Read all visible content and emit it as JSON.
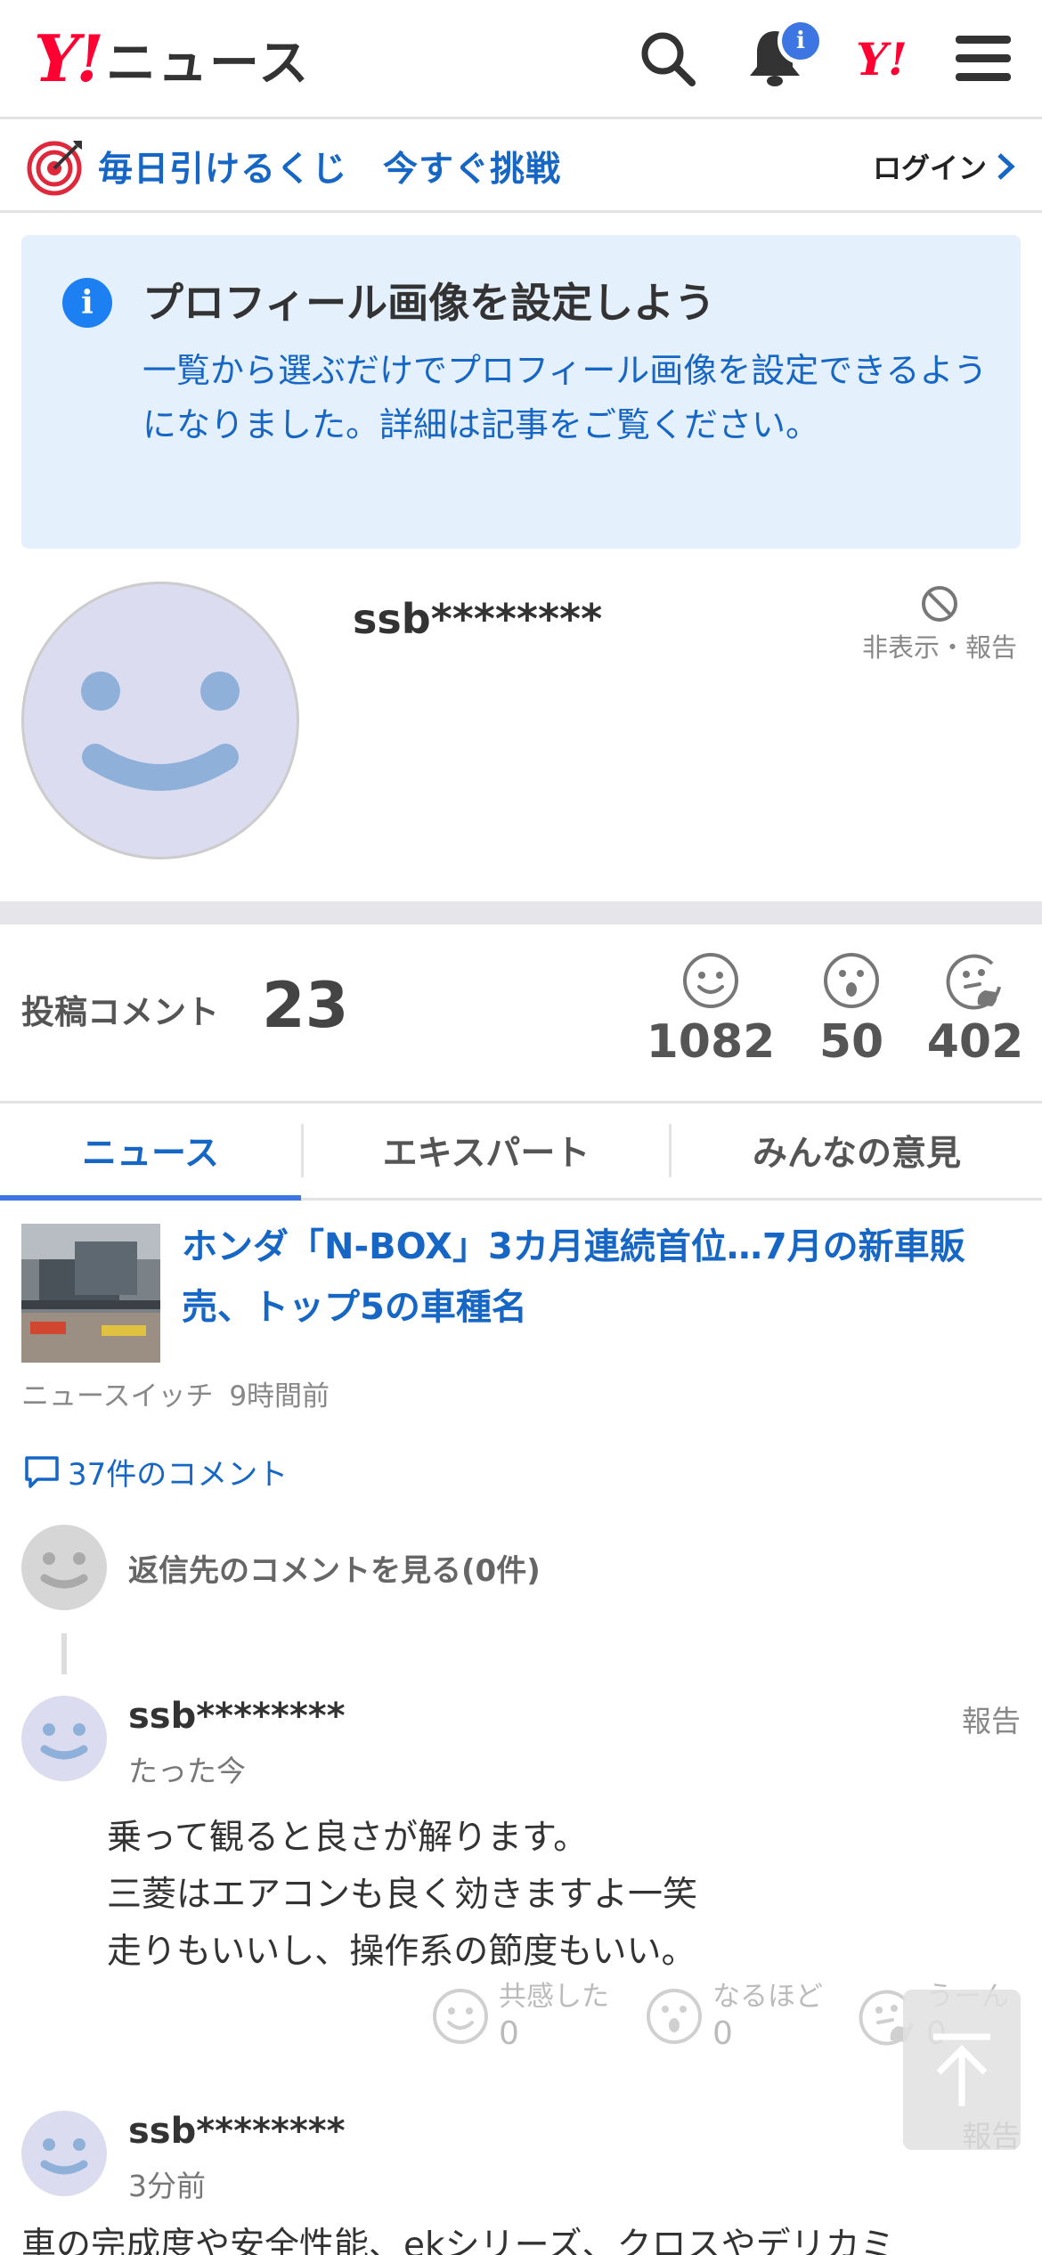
{
  "header": {
    "logo_mark": "Y!",
    "logo_text": "ニュース",
    "notification_badge": "i",
    "yahoo_short": "Y!"
  },
  "lottery": {
    "label": "毎日引けるくじ　今すぐ挑戦",
    "login_label": "ログイン"
  },
  "notice": {
    "title": "プロフィール画像を設定しよう",
    "body": "一覧から選ぶだけでプロフィール画像を設定できるようになりました。詳細は記事をご覧ください。"
  },
  "profile": {
    "username": "ssb********",
    "hide_report_label": "非表示・報告"
  },
  "stats": {
    "label": "投稿コメント",
    "count": "23",
    "reactions": [
      {
        "icon": "smile-icon",
        "count": "1082"
      },
      {
        "icon": "surprised-icon",
        "count": "50"
      },
      {
        "icon": "thinking-icon",
        "count": "402"
      }
    ]
  },
  "tabs": [
    {
      "label": "ニュース",
      "active": true
    },
    {
      "label": "エキスパート",
      "active": false
    },
    {
      "label": "みんなの意見",
      "active": false
    }
  ],
  "article": {
    "title": "ホンダ「N-BOX」3カ月連続首位…7月の新車販売、トップ5の車種名",
    "source": "ニュースイッチ",
    "time": "9時間前",
    "comment_link": "37件のコメント"
  },
  "reply_link": "返信先のコメントを見る(0件)",
  "comments": [
    {
      "username": "ssb********",
      "time": "たった今",
      "report": "報告",
      "lines": [
        "乗って観ると良さが解ります。",
        "三菱はエアコンも良く効きますよ一笑",
        "走りもいいし、操作系の節度もいい。"
      ],
      "reactions": [
        {
          "label": "共感した",
          "count": "0"
        },
        {
          "label": "なるほど",
          "count": "0"
        },
        {
          "label": "うーん",
          "count": "0"
        }
      ]
    },
    {
      "username": "ssb********",
      "time": "3分前",
      "report": "報告",
      "lines": [
        "車の完成度や安全性能、ekシリーズ、クロスやデリカミ"
      ]
    }
  ],
  "colors": {
    "brand_red": "#ff0033",
    "link_blue": "#1666c5",
    "notice_bg": "#e5f0fd",
    "tab_underline": "#3d76e2"
  }
}
